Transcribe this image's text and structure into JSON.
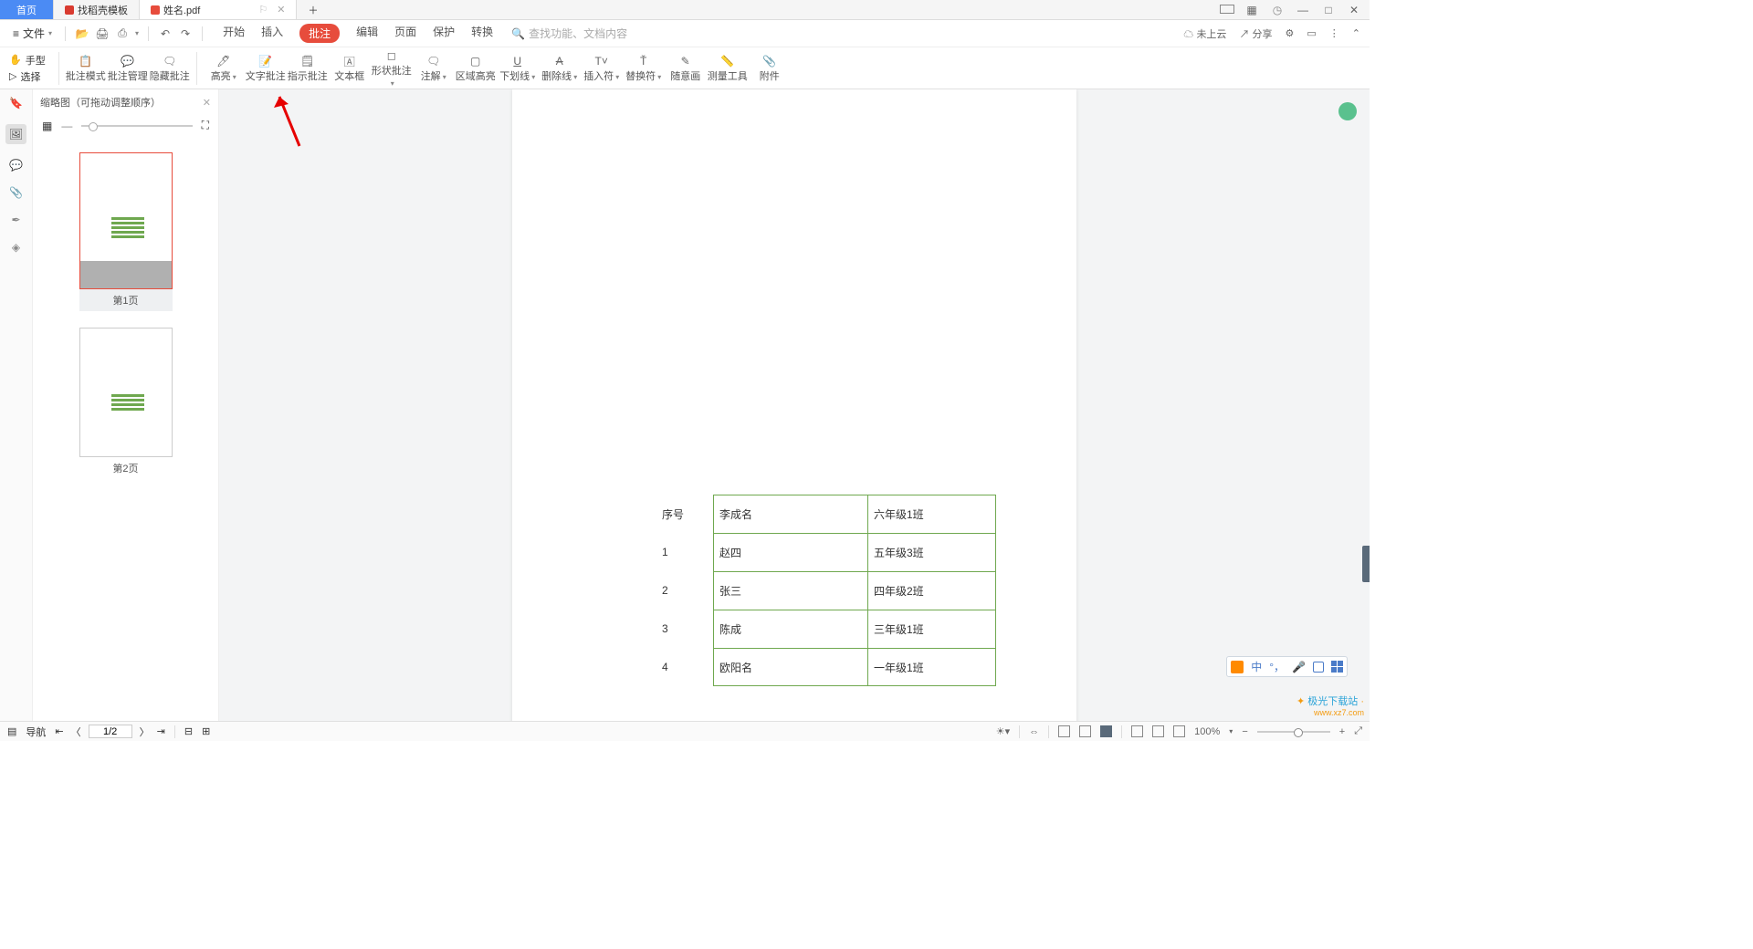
{
  "tabs": {
    "home": "首页",
    "template": "找稻壳模板",
    "file": "姓名.pdf"
  },
  "menu": {
    "file": "文件",
    "items": [
      "开始",
      "插入",
      "批注",
      "编辑",
      "页面",
      "保护",
      "转换"
    ],
    "search_ph": "查找功能、文档内容",
    "not_cloud": "未上云",
    "share": "分享"
  },
  "tool_modes": {
    "hand": "手型",
    "select": "选择"
  },
  "ribbon": {
    "annot_mode": "批注模式",
    "annot_manage": "批注管理",
    "hide_annot": "隐藏批注",
    "highlight": "高亮",
    "text_annot": "文字批注",
    "indicate": "指示批注",
    "textbox": "文本框",
    "shape_annot": "形状批注",
    "note": "注解",
    "area_hl": "区域高亮",
    "underline": "下划线",
    "strike": "删除线",
    "caret": "插入符",
    "replace": "替换符",
    "freehand": "随意画",
    "measure": "测量工具",
    "attach": "附件"
  },
  "thumb": {
    "title": "缩略图（可拖动调整顺序）",
    "p1": "第1页",
    "p2": "第2页"
  },
  "doc": {
    "header": "序号",
    "rows": [
      {
        "n": "",
        "a": "李成名",
        "b": "六年级1班"
      },
      {
        "n": "1",
        "a": "赵四",
        "b": "五年级3班"
      },
      {
        "n": "2",
        "a": "张三",
        "b": "四年级2班"
      },
      {
        "n": "3",
        "a": "陈成",
        "b": "三年级1班"
      },
      {
        "n": "4",
        "a": "欧阳名",
        "b": "一年级1班"
      }
    ]
  },
  "ime": {
    "lang": "中",
    "punct": "°，"
  },
  "status": {
    "nav": "导航",
    "page": "1/2",
    "zoom": "100%"
  },
  "watermark": {
    "a": "极光",
    "b": "下载站",
    "url": "www.xz7.com"
  }
}
